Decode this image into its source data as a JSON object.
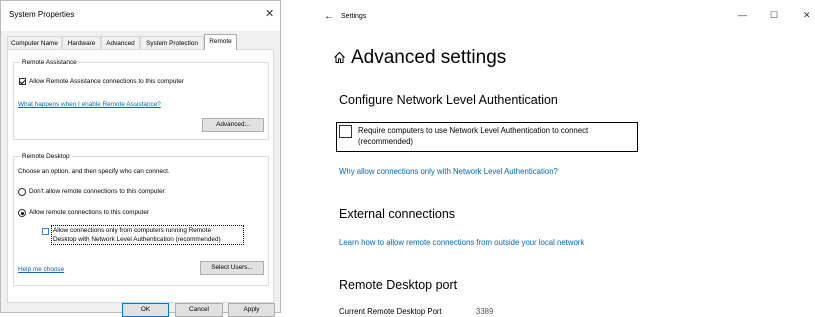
{
  "system_properties": {
    "title": "System Properties",
    "close_glyph": "✕",
    "tabs": [
      "Computer Name",
      "Hardware",
      "Advanced",
      "System Protection",
      "Remote"
    ],
    "active_tab": "Remote",
    "remote_assistance": {
      "group_label": "Remote Assistance",
      "allow_label": "Allow Remote Assistance connections to this computer",
      "allow_checked": true,
      "help_link": "What happens when I enable Remote Assistance?",
      "advanced_button": "Advanced..."
    },
    "remote_desktop": {
      "group_label": "Remote Desktop",
      "instruction": "Choose an option, and then specify who can connect.",
      "option_dont_allow": "Don't allow remote connections to this computer",
      "option_allow": "Allow remote connections to this computer",
      "selected_option": "Allow remote connections to this computer",
      "nla_label_line1": "Allow connections only from computers running Remote",
      "nla_label_line2": "Desktop with Network Level Authentication (recommended)",
      "nla_checked": false,
      "help_me_choose": "Help me choose",
      "select_users_button": "Select Users..."
    },
    "buttons": {
      "ok": "OK",
      "cancel": "Cancel",
      "apply": "Apply"
    }
  },
  "settings": {
    "window_title": "Settings",
    "back_glyph": "←",
    "minimize_glyph": "—",
    "maximize_glyph": "☐",
    "close_glyph": "✕",
    "page_title": "Advanced settings",
    "nla_section": {
      "heading": "Configure Network Level Authentication",
      "checkbox_line1": "Require computers to use Network Level Authentication to connect",
      "checkbox_line2": "(recommended)",
      "checked": false,
      "link": "Why allow connections only with Network Level Authentication?"
    },
    "external_section": {
      "heading": "External connections",
      "link": "Learn how to allow remote connections from outside your local network"
    },
    "port_section": {
      "heading": "Remote Desktop port",
      "label": "Current Remote Desktop Port",
      "value": "3389"
    },
    "accent_color": "#0067c0"
  }
}
